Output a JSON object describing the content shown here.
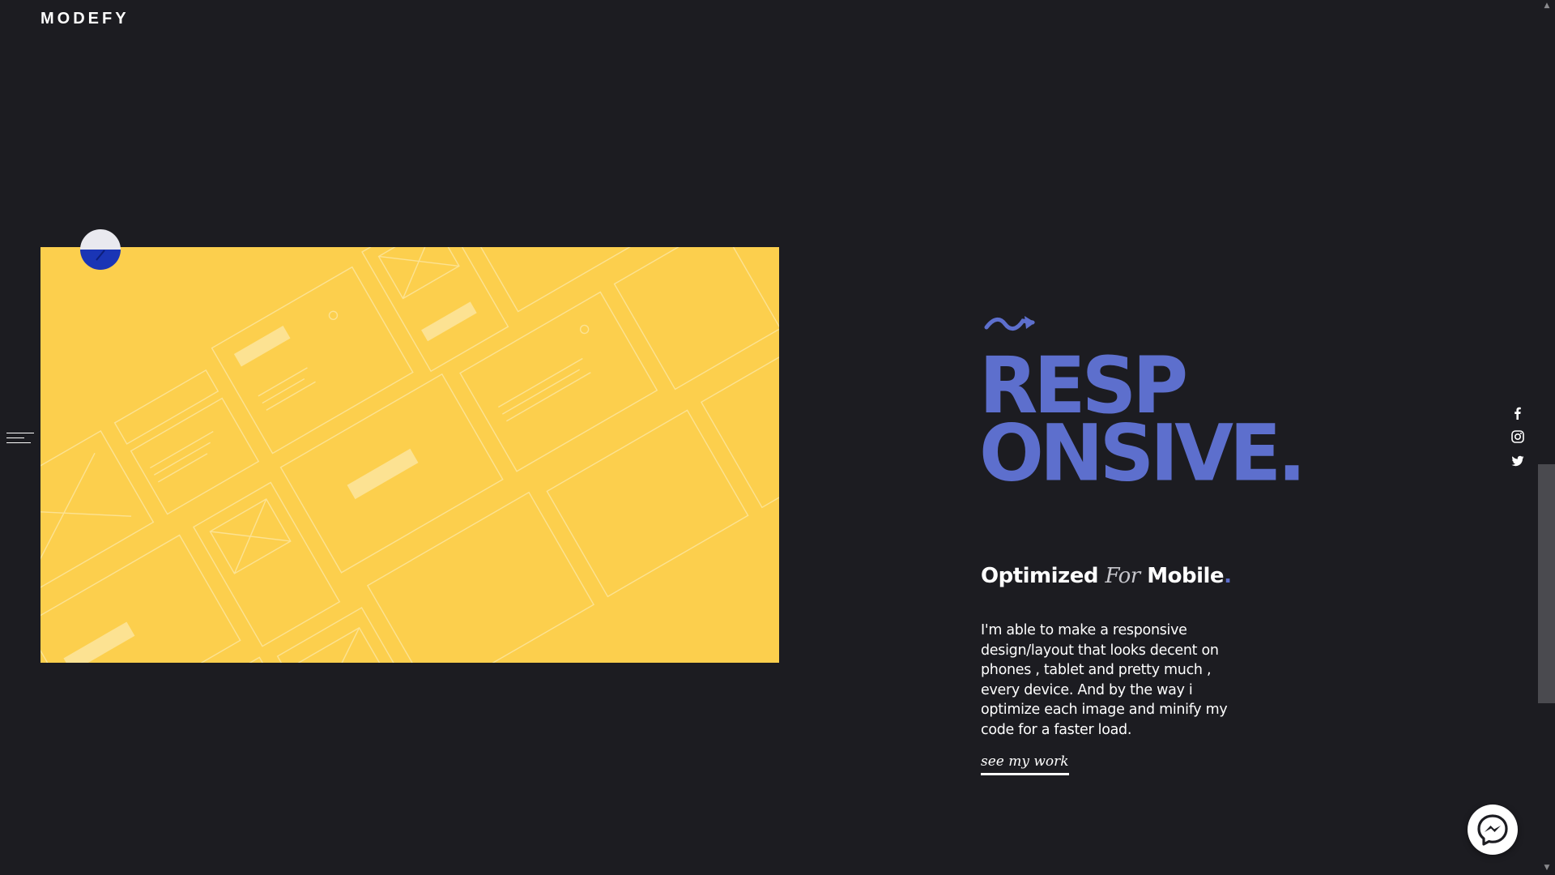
{
  "brand": {
    "name": "MODEFY"
  },
  "hero": {
    "heading_line1": "RESP",
    "heading_line2": "ONSIVE.",
    "subheading": {
      "part1": "Optimized",
      "part2": "For",
      "part3": "Mobile",
      "part4": "."
    },
    "description": "I'm able to make a responsive design/layout that looks decent on phones , tablet and pretty much , every device. And by the way i optimize each image and minify my code for a faster load.",
    "cta_label": "see my work"
  },
  "social": {
    "facebook_icon": "f",
    "instagram_icon": "instagram-icon",
    "twitter_icon": "twitter-icon"
  },
  "colors": {
    "background": "#1c1c21",
    "accent": "#5d6fcd",
    "image_background": "#fccf4d",
    "indicator_top": "#e9e9ef",
    "indicator_bottom": "#1a35b5"
  },
  "icons": {
    "menu": "hamburger-menu-icon",
    "arrow": "squiggle-arrow-icon",
    "chat": "messenger-icon"
  }
}
